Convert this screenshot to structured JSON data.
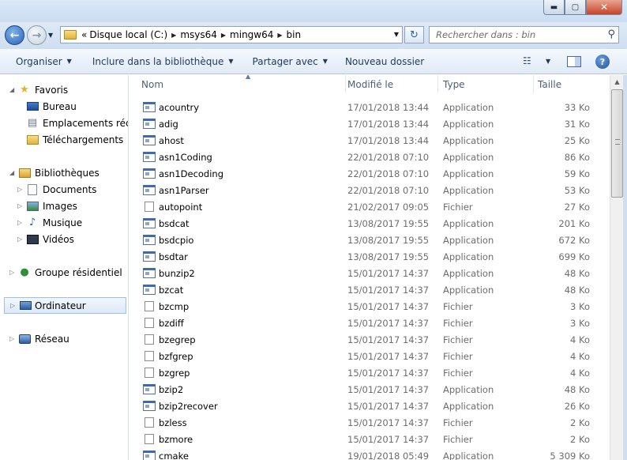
{
  "window": {
    "min_label": "▬",
    "max_label": "▢",
    "close_label": "✕"
  },
  "address": {
    "overflow": "«",
    "crumbs": [
      "Disque local (C:)",
      "msys64",
      "mingw64",
      "bin"
    ]
  },
  "search": {
    "placeholder": "Rechercher dans : bin"
  },
  "toolbar": {
    "organize": "Organiser",
    "include": "Inclure dans la bibliothèque",
    "share": "Partager avec",
    "new_folder": "Nouveau dossier"
  },
  "nav": {
    "favorites": "Favoris",
    "desktop": "Bureau",
    "recent": "Emplacements récents",
    "downloads": "Téléchargements",
    "libraries": "Bibliothèques",
    "documents": "Documents",
    "images": "Images",
    "music": "Musique",
    "videos": "Vidéos",
    "homegroup": "Groupe résidentiel",
    "computer": "Ordinateur",
    "network": "Réseau"
  },
  "columns": {
    "name": "Nom",
    "date": "Modifié le",
    "type": "Type",
    "size": "Taille"
  },
  "files": [
    {
      "name": "acountry",
      "date": "17/01/2018 13:44",
      "type": "Application",
      "size": "33 Ko",
      "icon": "app"
    },
    {
      "name": "adig",
      "date": "17/01/2018 13:44",
      "type": "Application",
      "size": "31 Ko",
      "icon": "app"
    },
    {
      "name": "ahost",
      "date": "17/01/2018 13:44",
      "type": "Application",
      "size": "25 Ko",
      "icon": "app"
    },
    {
      "name": "asn1Coding",
      "date": "22/01/2018 07:10",
      "type": "Application",
      "size": "86 Ko",
      "icon": "app"
    },
    {
      "name": "asn1Decoding",
      "date": "22/01/2018 07:10",
      "type": "Application",
      "size": "59 Ko",
      "icon": "app"
    },
    {
      "name": "asn1Parser",
      "date": "22/01/2018 07:10",
      "type": "Application",
      "size": "53 Ko",
      "icon": "app"
    },
    {
      "name": "autopoint",
      "date": "21/02/2017 09:05",
      "type": "Fichier",
      "size": "27 Ko",
      "icon": "file"
    },
    {
      "name": "bsdcat",
      "date": "13/08/2017 19:55",
      "type": "Application",
      "size": "201 Ko",
      "icon": "app"
    },
    {
      "name": "bsdcpio",
      "date": "13/08/2017 19:55",
      "type": "Application",
      "size": "672 Ko",
      "icon": "app"
    },
    {
      "name": "bsdtar",
      "date": "13/08/2017 19:55",
      "type": "Application",
      "size": "699 Ko",
      "icon": "app"
    },
    {
      "name": "bunzip2",
      "date": "15/01/2017 14:37",
      "type": "Application",
      "size": "48 Ko",
      "icon": "app"
    },
    {
      "name": "bzcat",
      "date": "15/01/2017 14:37",
      "type": "Application",
      "size": "48 Ko",
      "icon": "app"
    },
    {
      "name": "bzcmp",
      "date": "15/01/2017 14:37",
      "type": "Fichier",
      "size": "3 Ko",
      "icon": "file"
    },
    {
      "name": "bzdiff",
      "date": "15/01/2017 14:37",
      "type": "Fichier",
      "size": "3 Ko",
      "icon": "file"
    },
    {
      "name": "bzegrep",
      "date": "15/01/2017 14:37",
      "type": "Fichier",
      "size": "4 Ko",
      "icon": "file"
    },
    {
      "name": "bzfgrep",
      "date": "15/01/2017 14:37",
      "type": "Fichier",
      "size": "4 Ko",
      "icon": "file"
    },
    {
      "name": "bzgrep",
      "date": "15/01/2017 14:37",
      "type": "Fichier",
      "size": "4 Ko",
      "icon": "file"
    },
    {
      "name": "bzip2",
      "date": "15/01/2017 14:37",
      "type": "Application",
      "size": "48 Ko",
      "icon": "app"
    },
    {
      "name": "bzip2recover",
      "date": "15/01/2017 14:37",
      "type": "Application",
      "size": "26 Ko",
      "icon": "app"
    },
    {
      "name": "bzless",
      "date": "15/01/2017 14:37",
      "type": "Fichier",
      "size": "2 Ko",
      "icon": "file"
    },
    {
      "name": "bzmore",
      "date": "15/01/2017 14:37",
      "type": "Fichier",
      "size": "2 Ko",
      "icon": "file"
    },
    {
      "name": "cmake",
      "date": "19/01/2018 05:49",
      "type": "Application",
      "size": "5 309 Ko",
      "icon": "app"
    }
  ]
}
